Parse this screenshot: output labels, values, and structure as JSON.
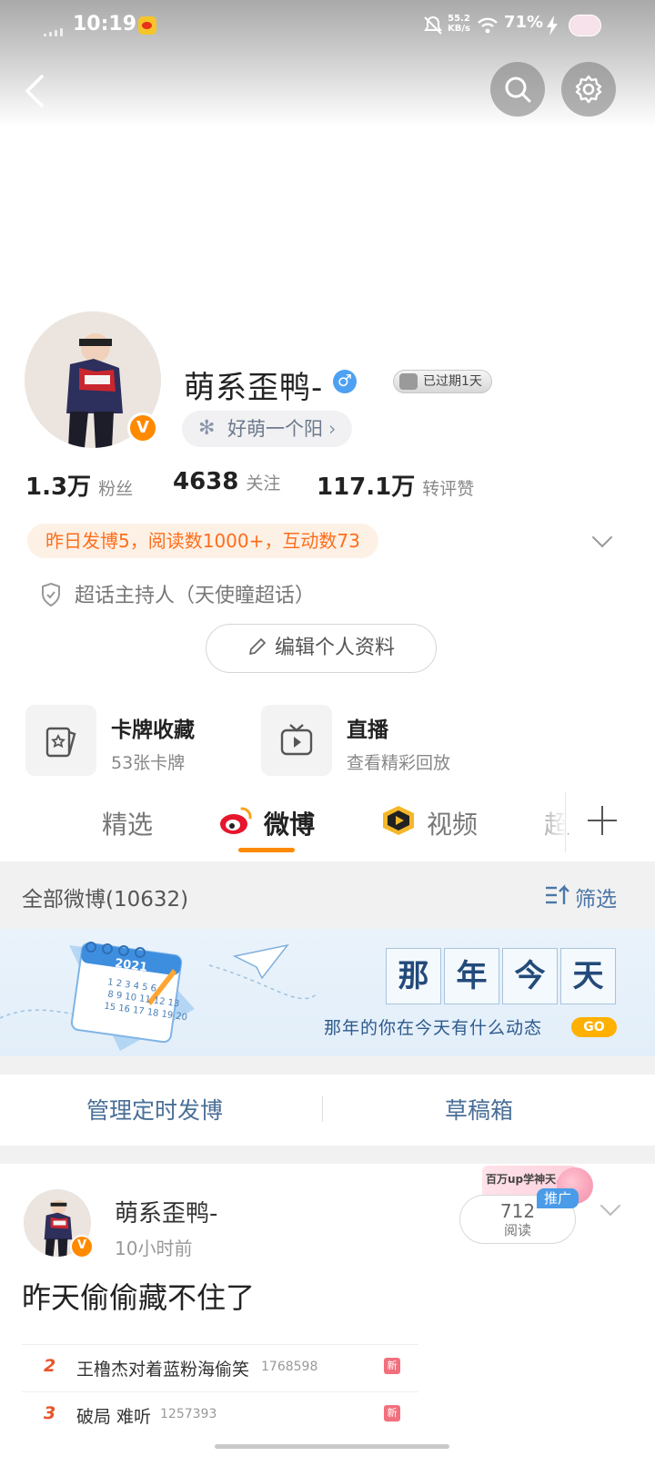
{
  "status_bar": {
    "time": "10:19",
    "net_speed": "55.2",
    "net_unit": "KB/s",
    "battery": "71%"
  },
  "header": {
    "back_icon": "chevron-left-icon",
    "search_icon": "search-icon",
    "settings_icon": "gear-icon"
  },
  "profile": {
    "name": "萌系歪鸭-",
    "gender_symbol": "♂",
    "vip_label": "已过期1天",
    "tag_label": "好萌一个阳",
    "verified_symbol": "V",
    "stats": [
      {
        "value": "1.3万",
        "label": "粉丝"
      },
      {
        "value": "4638",
        "label": "关注"
      },
      {
        "value": "117.1万",
        "label": "转评赞"
      }
    ],
    "activity": "昨日发博5，阅读数1000+，互动数73",
    "host": "超话主持人（天使瞳超话）",
    "edit_button": "编辑个人资料"
  },
  "cards": [
    {
      "title": "卡牌收藏",
      "subtitle": "53张卡牌"
    },
    {
      "title": "直播",
      "subtitle": "查看精彩回放"
    }
  ],
  "tabs": [
    {
      "label": "精选"
    },
    {
      "label": "微博"
    },
    {
      "label": "视频"
    },
    {
      "label": "超"
    }
  ],
  "list_header": {
    "all": "全部微博(10632)",
    "filter": "筛选"
  },
  "banner": {
    "year": "2021",
    "chars": [
      "那",
      "年",
      "今",
      "天"
    ],
    "subtitle": "那年的你在今天有什么动态",
    "go": "GO",
    "calendar_rows": [
      "1 2 3 4 5 6",
      "8 9 10 11 12 13",
      "15 16 17 18 19 20"
    ]
  },
  "actions": {
    "scheduled": "管理定时发博",
    "drafts": "草稿箱"
  },
  "post": {
    "author": "萌系歪鸭-",
    "time": "10小时前",
    "reads": "712",
    "reads_label": "阅读",
    "promo_text": "百万up学神天...",
    "promo_tag": "推广",
    "text": "昨天偷偷藏不住了",
    "hot_list": [
      {
        "rank": "2",
        "title": "王橹杰对着蓝粉海偷笑",
        "count": "1768598",
        "badge": "新"
      },
      {
        "rank": "3",
        "title": "破局 难听",
        "count": "1257393",
        "badge": "新"
      }
    ]
  },
  "colors": {
    "accent": "#ff8a00",
    "link": "#4a76a8",
    "activity_text": "#ff6d1a",
    "activity_bg": "#fdf1e6"
  }
}
